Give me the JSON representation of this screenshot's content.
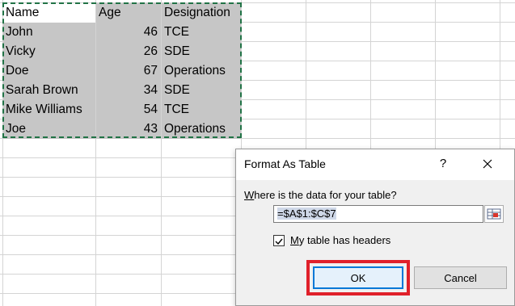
{
  "sheet": {
    "rows": [
      [
        "Name",
        "Age",
        "Designation"
      ],
      [
        "John",
        "46",
        "TCE"
      ],
      [
        "Vicky",
        "26",
        "SDE"
      ],
      [
        "Doe",
        "67",
        "Operations"
      ],
      [
        "Sarah Brown",
        "34",
        "SDE"
      ],
      [
        "Mike Williams",
        "54",
        "TCE"
      ],
      [
        "Joe",
        "43",
        "Operations"
      ]
    ]
  },
  "dialog": {
    "title": "Format As Table",
    "help_label": "?",
    "where_prefix": "",
    "where_access_key": "W",
    "where_rest": "here is the data for your table?",
    "range_value": "=$A$1:$C$7",
    "headers_checked": true,
    "headers_access_key": "M",
    "headers_rest": "y table has headers",
    "ok_label": "OK",
    "cancel_label": "Cancel"
  },
  "colors": {
    "selection_fill": "#c6c6c6",
    "marching_ants": "#217346",
    "highlight_box": "#e0202a",
    "default_button_border": "#0078d7"
  },
  "icons": {
    "close": "close-icon",
    "collapse": "range-collapse-icon",
    "check": "checkmark-icon"
  }
}
